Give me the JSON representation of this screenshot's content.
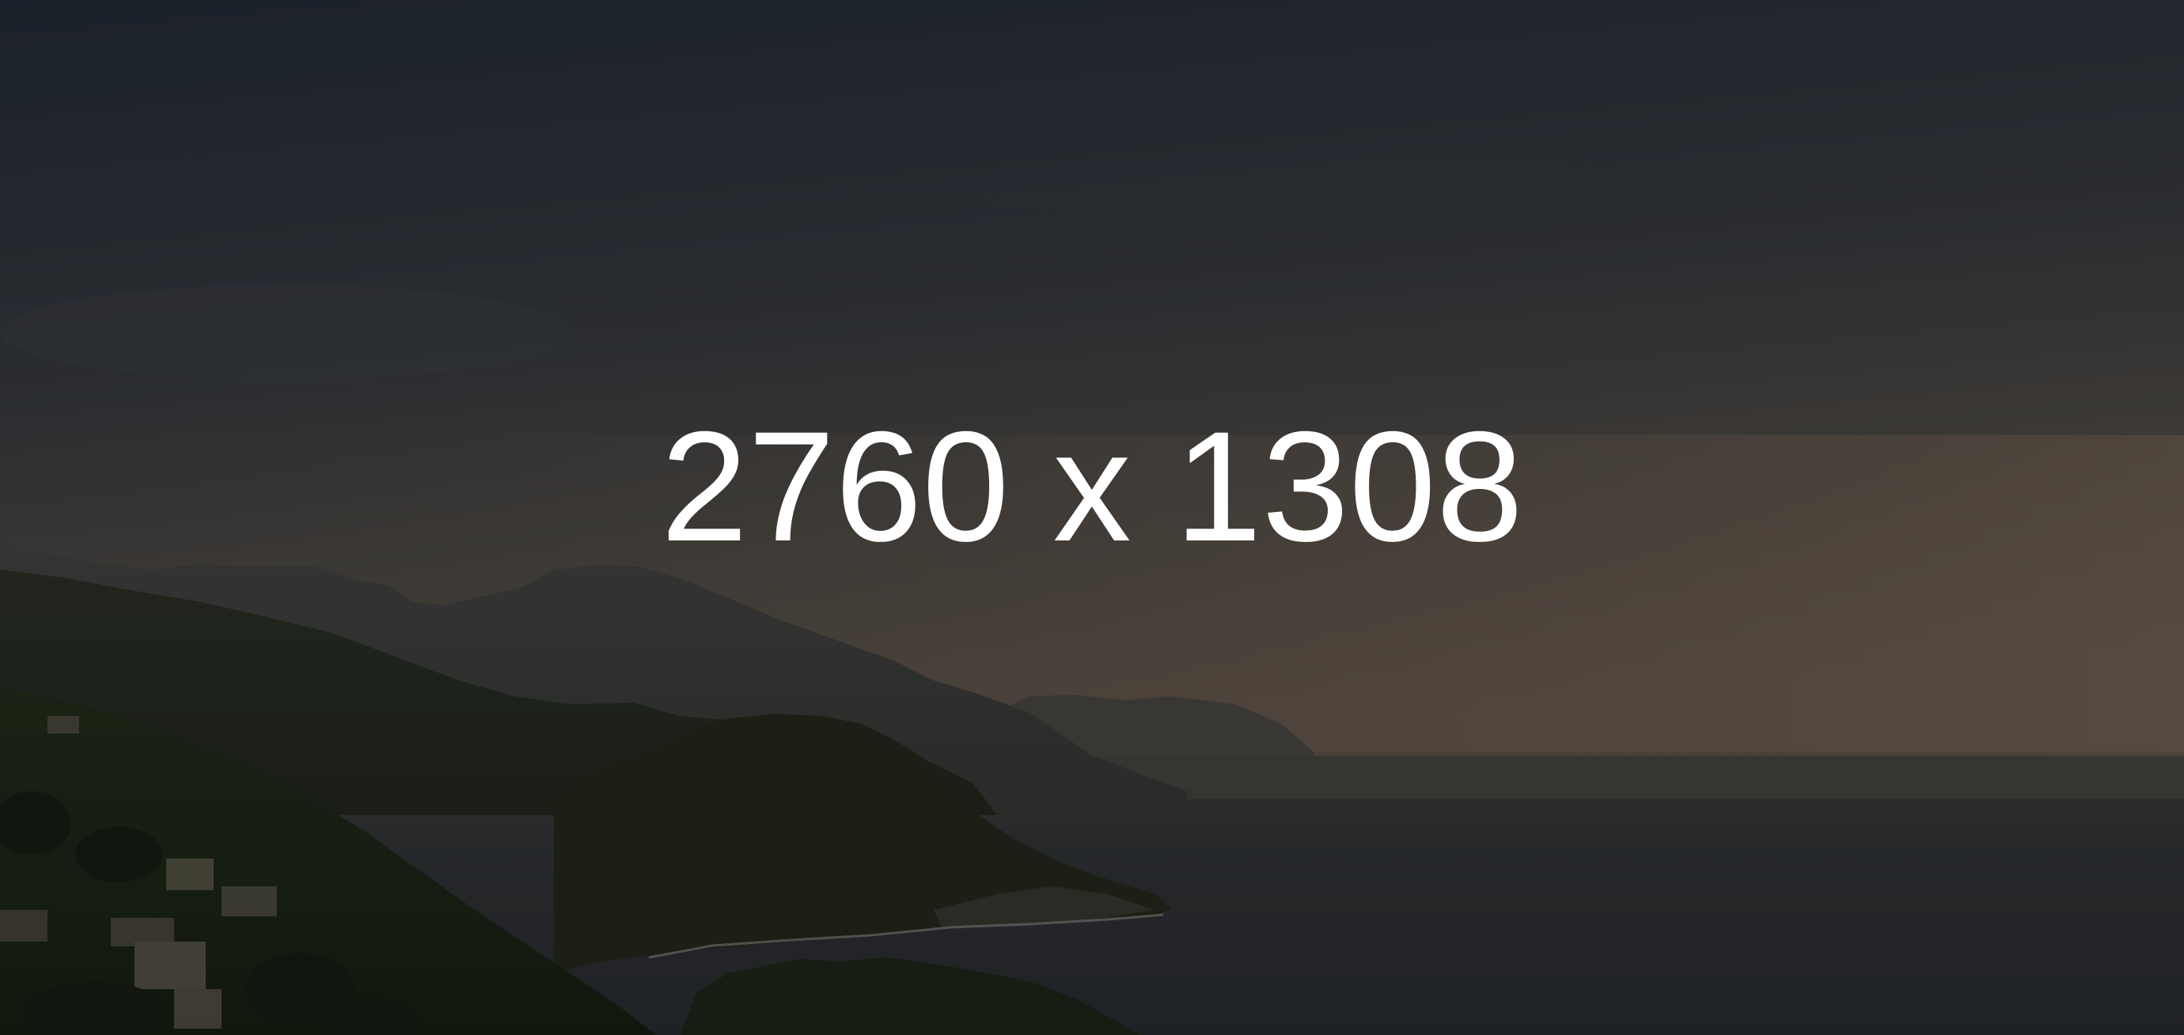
{
  "placeholder": {
    "label": "2760 x 1308"
  },
  "colors": {
    "text": "#ffffff",
    "sky_top": "#1f2630",
    "sky_horizon": "#564c43",
    "sea": "#2a2c30",
    "hills_near": "#1c2416",
    "hills_far": "#3a3a3a"
  }
}
